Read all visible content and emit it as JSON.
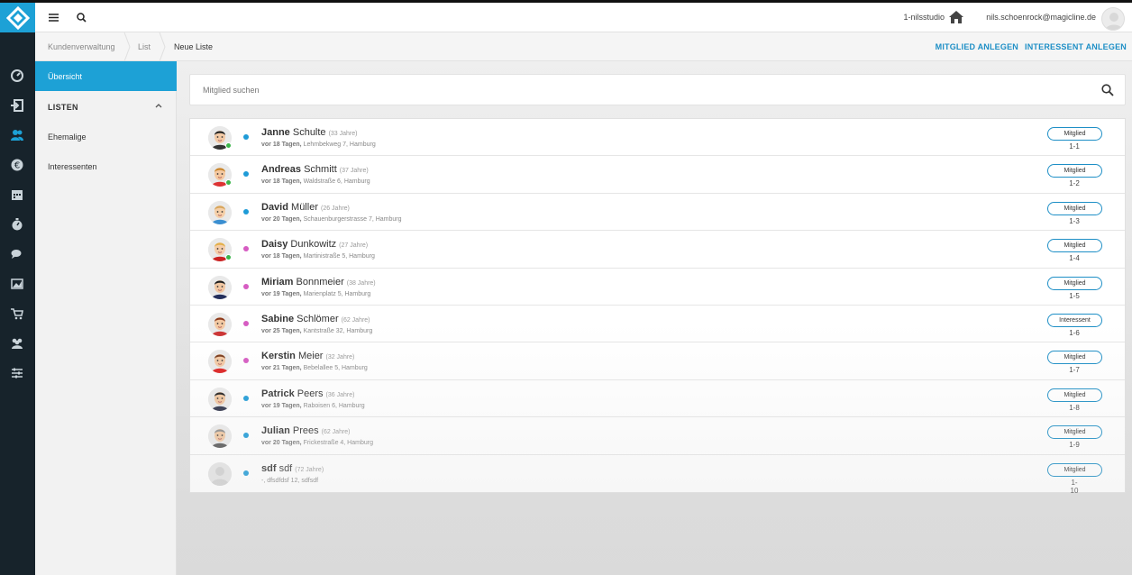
{
  "topbar": {
    "studio": "1-nilsstudio",
    "email": "nils.schoenrock@magicline.de"
  },
  "breadcrumb": [
    "Kundenverwaltung",
    "List",
    "Neue Liste"
  ],
  "actions": {
    "add_member": "MITGLIED ANLEGEN",
    "add_prospect": "INTERESSENT ANLEGEN"
  },
  "sidebar": {
    "active": "Übersicht",
    "section": "LISTEN",
    "items": [
      "Ehemalige",
      "Interessenten"
    ]
  },
  "search": {
    "placeholder": "Mitglied suchen"
  },
  "colors": {
    "accent": "#1da1d6",
    "dot_blue": "#1e9bd7",
    "dot_pink": "#d65cc2",
    "online": "#3bb54a"
  },
  "members": [
    {
      "first": "Janne",
      "last": "Schulte",
      "age": "(33 Jahre)",
      "when": "vor 18 Tagen,",
      "address": "Lehmbekweg 7, Hamburg",
      "badge": "Mitglied",
      "id": "1-1",
      "dot": "blue",
      "online": true,
      "avatar": "male-cap"
    },
    {
      "first": "Andreas",
      "last": "Schmitt",
      "age": "(37 Jahre)",
      "when": "vor 18 Tagen,",
      "address": "Waldstraße 6, Hamburg",
      "badge": "Mitglied",
      "id": "1-2",
      "dot": "blue",
      "online": true,
      "avatar": "male-red"
    },
    {
      "first": "David",
      "last": "Müller",
      "age": "(26 Jahre)",
      "when": "vor 20 Tagen,",
      "address": "Schauenburgerstrasse 7, Hamburg",
      "badge": "Mitglied",
      "id": "1-3",
      "dot": "blue",
      "online": false,
      "avatar": "male-blue"
    },
    {
      "first": "Daisy",
      "last": "Dunkowitz",
      "age": "(27 Jahre)",
      "when": "vor 18 Tagen,",
      "address": "Martinistraße 5, Hamburg",
      "badge": "Mitglied",
      "id": "1-4",
      "dot": "pink",
      "online": true,
      "avatar": "female-blonde"
    },
    {
      "first": "Miriam",
      "last": "Bonnmeier",
      "age": "(38 Jahre)",
      "when": "vor 19 Tagen,",
      "address": "Marienplatz 5, Hamburg",
      "badge": "Mitglied",
      "id": "1-5",
      "dot": "pink",
      "online": false,
      "avatar": "female-dark"
    },
    {
      "first": "Sabine",
      "last": "Schlömer",
      "age": "(62 Jahre)",
      "when": "vor 25 Tagen,",
      "address": "Kantstraße 32, Hamburg",
      "badge": "Interessent",
      "id": "1-6",
      "dot": "pink",
      "online": false,
      "avatar": "female-red"
    },
    {
      "first": "Kerstin",
      "last": "Meier",
      "age": "(32 Jahre)",
      "when": "vor 21 Tagen,",
      "address": "Bebelallee 5, Hamburg",
      "badge": "Mitglied",
      "id": "1-7",
      "dot": "pink",
      "online": false,
      "avatar": "female-brown"
    },
    {
      "first": "Patrick",
      "last": "Peers",
      "age": "(36 Jahre)",
      "when": "vor 19 Tagen,",
      "address": "Raboisen 6, Hamburg",
      "badge": "Mitglied",
      "id": "1-8",
      "dot": "blue",
      "online": false,
      "avatar": "male-dark"
    },
    {
      "first": "Julian",
      "last": "Prees",
      "age": "(62 Jahre)",
      "when": "vor 20 Tagen,",
      "address": "Frickestraße 4, Hamburg",
      "badge": "Mitglied",
      "id": "1-9",
      "dot": "blue",
      "online": false,
      "avatar": "male-grey"
    },
    {
      "first": "sdf",
      "last": "sdf",
      "age": "(72 Jahre)",
      "when": "",
      "address": "-, dfsdfdsf 12, sdfsdf",
      "badge": "Mitglied",
      "id": "1-10",
      "dot": "blue",
      "online": false,
      "avatar": "placeholder"
    }
  ]
}
